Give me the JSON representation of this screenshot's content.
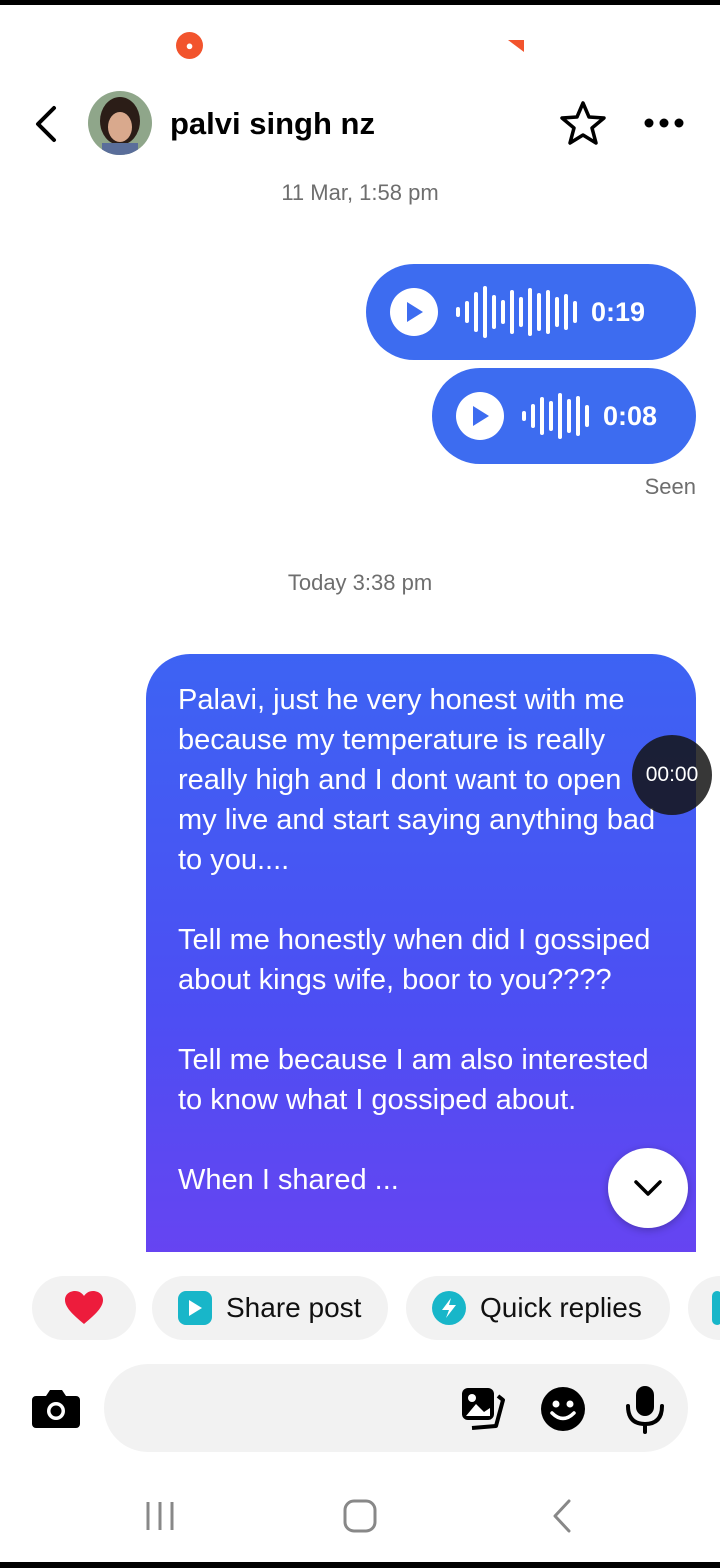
{
  "status_bar": {
    "rec_icon": "screen-record-icon"
  },
  "header": {
    "contact_name": "palvi singh nz",
    "back_icon": "chevron-left-icon",
    "star_icon": "star-outline-icon",
    "more_icon": "more-horizontal-icon"
  },
  "messages": {
    "timestamp_1": "11 Mar, 1:58 pm",
    "voice_1_duration": "0:19",
    "voice_2_duration": "0:08",
    "seen_label": "Seen",
    "timestamp_2": "Today 3:38 pm",
    "text_message": "Palavi, just he very honest with me because my temperature is really really high and I dont want to open my live and start saying anything bad to you....\n\nTell me honestly when did I gossiped about kings wife, boor to you????\n\nTell me because I am also interested to know what I gossiped about.\n\nWhen I shared ..."
  },
  "overlay": {
    "rec_timer": "00:00"
  },
  "quick_chips": {
    "heart": "heart-icon",
    "share_post": "Share post",
    "quick_replies": "Quick replies"
  },
  "composer": {
    "placeholder": ""
  },
  "colors": {
    "sent_bubble": "#3d6cf0",
    "gradient_end": "#7b3cf0",
    "chip_bg": "#f2f2f2"
  }
}
